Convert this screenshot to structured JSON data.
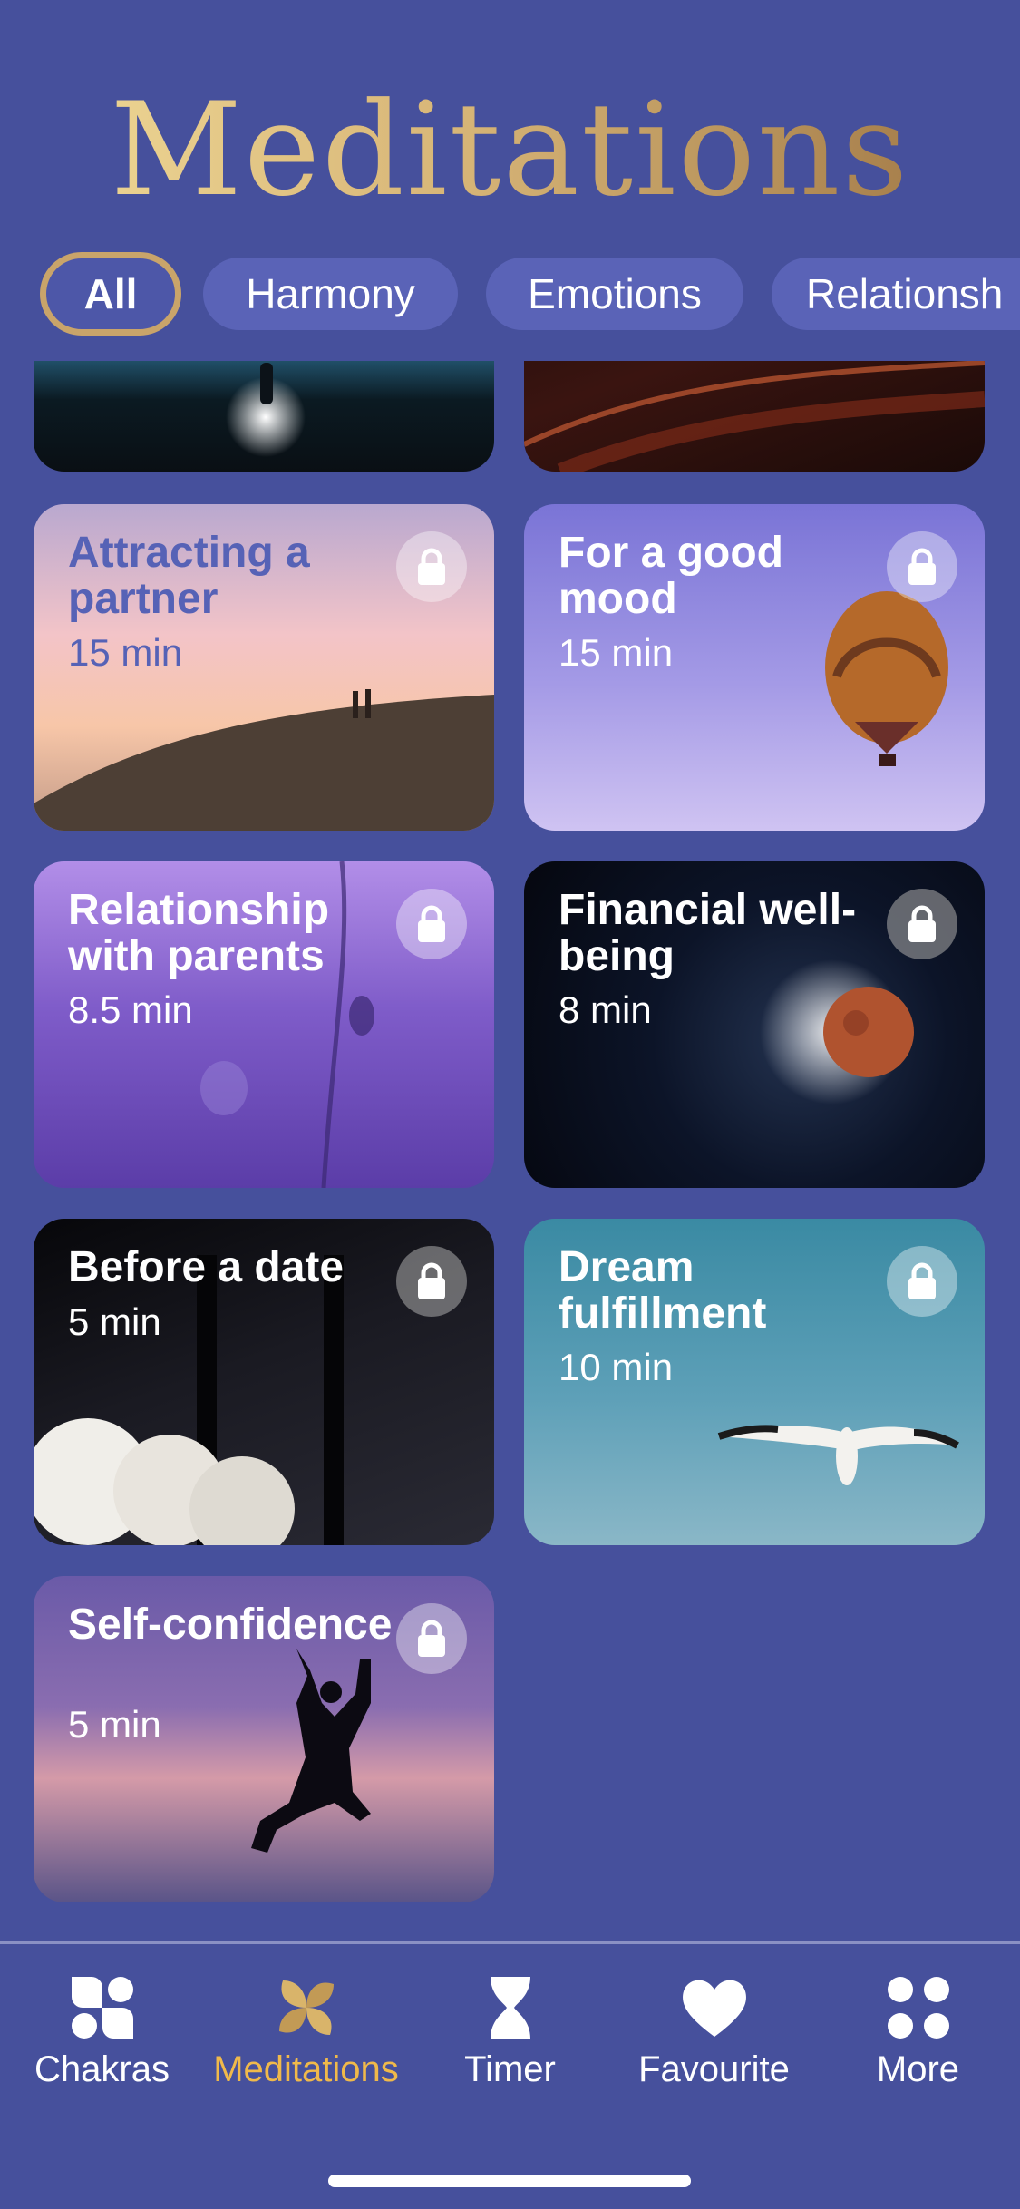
{
  "header": {
    "title": "Meditations"
  },
  "filters": [
    {
      "label": "All",
      "active": true
    },
    {
      "label": "Harmony",
      "active": false
    },
    {
      "label": "Emotions",
      "active": false
    },
    {
      "label": "Relationsh",
      "active": false
    }
  ],
  "cards": [
    {
      "title": "",
      "duration": "",
      "locked": false
    },
    {
      "title": "",
      "duration": "",
      "locked": false
    },
    {
      "title": "Attracting a partner",
      "duration": "15 min",
      "locked": true
    },
    {
      "title": "For a good mood",
      "duration": "15 min",
      "locked": true
    },
    {
      "title": "Relationship with parents",
      "duration": "8.5 min",
      "locked": true
    },
    {
      "title": "Financial well-being",
      "duration": "8 min",
      "locked": true
    },
    {
      "title": "Before a date",
      "duration": "5 min",
      "locked": true
    },
    {
      "title": "Dream fulfillment",
      "duration": "10 min",
      "locked": true
    },
    {
      "title": "Self-confidence",
      "duration": "5 min",
      "locked": true
    }
  ],
  "tabbar": {
    "items": [
      {
        "label": "Chakras",
        "icon": "chakras-icon",
        "active": false
      },
      {
        "label": "Meditations",
        "icon": "meditations-icon",
        "active": true
      },
      {
        "label": "Timer",
        "icon": "hourglass-icon",
        "active": false
      },
      {
        "label": "Favourite",
        "icon": "heart-icon",
        "active": false
      },
      {
        "label": "More",
        "icon": "grid-dots-icon",
        "active": false
      }
    ]
  },
  "colors": {
    "background": "#46509c",
    "accent_gold": "#f0b94a",
    "chip": "#5a63b7"
  }
}
